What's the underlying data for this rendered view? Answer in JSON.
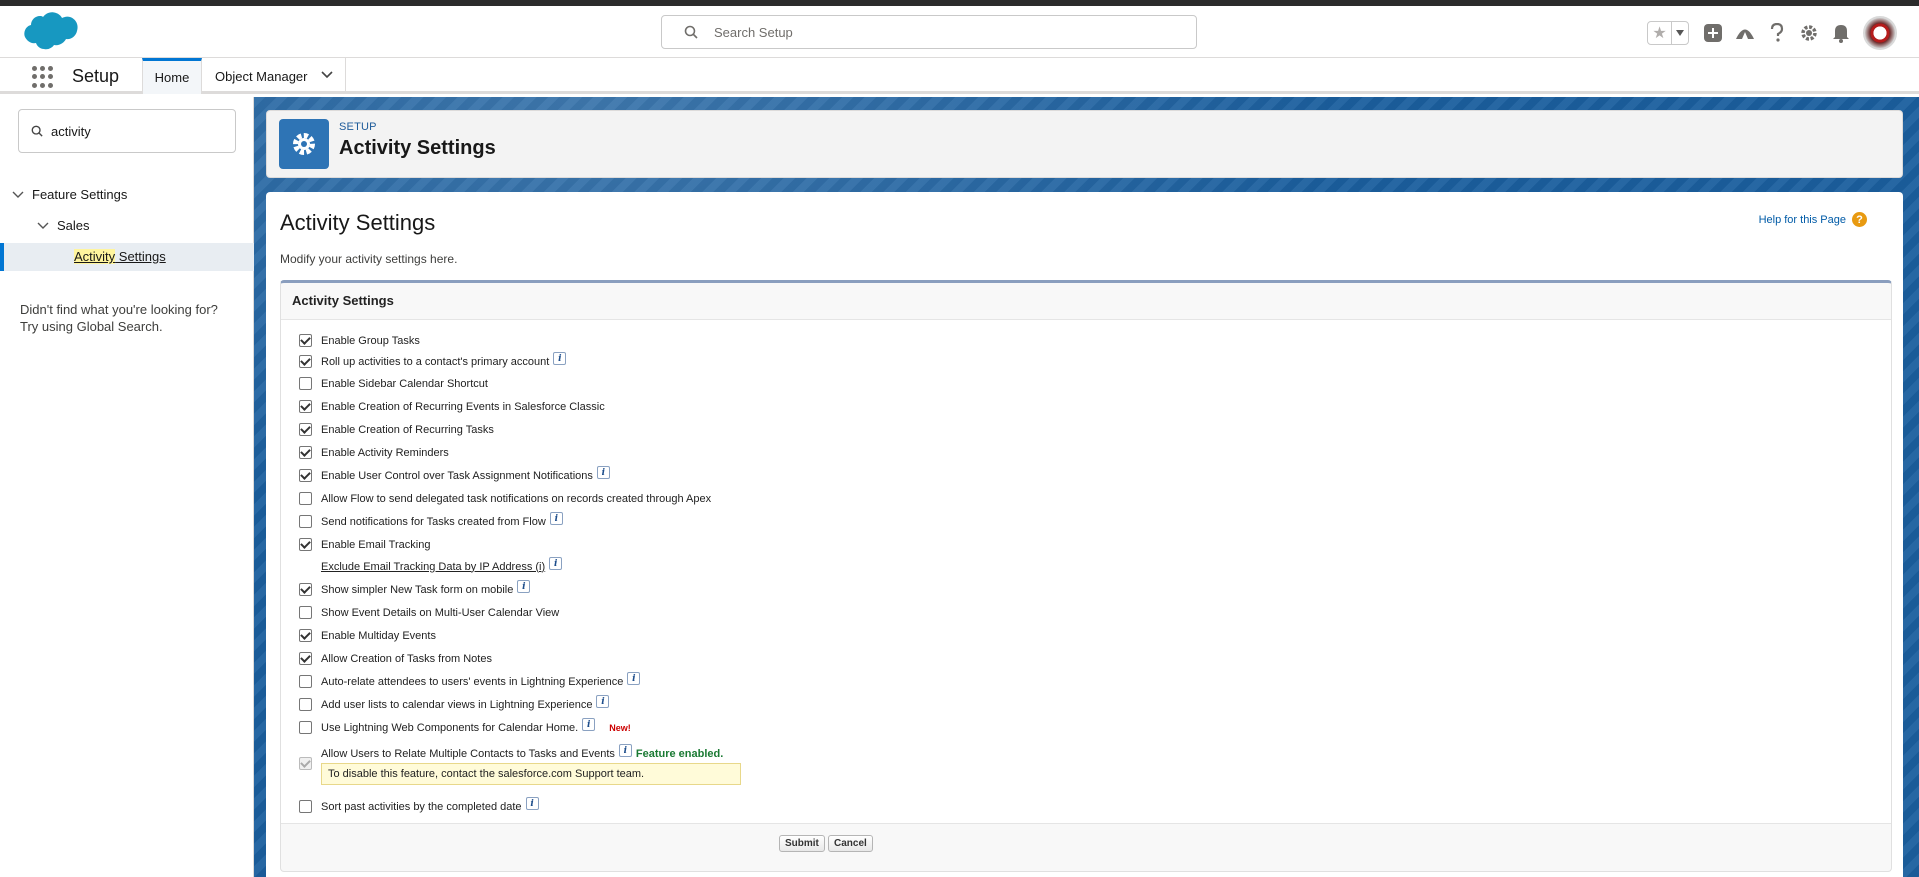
{
  "header": {
    "search_placeholder": "Search Setup"
  },
  "appnav": {
    "app_name": "Setup",
    "tabs": [
      {
        "label": "Home"
      },
      {
        "label": "Object Manager"
      }
    ]
  },
  "sidebar": {
    "quickfind_value": "activity",
    "tree": {
      "level1": "Feature Settings",
      "level2": "Sales",
      "selected_highlight": "Activity",
      "selected_rest": " Settings"
    },
    "notfound_line1": "Didn't find what you're looking for?",
    "notfound_line2": "Try using Global Search."
  },
  "page_header": {
    "eyebrow": "SETUP",
    "title": "Activity Settings"
  },
  "content": {
    "title": "Activity Settings",
    "help_link": "Help for this Page",
    "description": "Modify your activity settings here.",
    "block_title": "Activity Settings",
    "options": [
      {
        "label": "Enable Group Tasks",
        "checked": true
      },
      {
        "label": "Roll up activities to a contact's primary account",
        "checked": true
      },
      {
        "label": "Enable Sidebar Calendar Shortcut",
        "checked": false
      },
      {
        "label": "Enable Creation of Recurring Events in Salesforce Classic",
        "checked": true
      },
      {
        "label": "Enable Creation of Recurring Tasks",
        "checked": true
      },
      {
        "label": "Enable Activity Reminders",
        "checked": true
      },
      {
        "label": "Enable User Control over Task Assignment Notifications",
        "checked": true
      },
      {
        "label": "Allow Flow to send delegated task notifications on records created through Apex",
        "checked": false
      },
      {
        "label": "Send notifications for Tasks created from Flow",
        "checked": false
      },
      {
        "label": "Enable Email Tracking",
        "checked": true
      },
      {
        "label": "Exclude Email Tracking Data by IP Address (i)"
      },
      {
        "label": "Show simpler New Task form on mobile",
        "checked": true
      },
      {
        "label": "Show Event Details on Multi-User Calendar View",
        "checked": false
      },
      {
        "label": "Enable Multiday Events",
        "checked": true
      },
      {
        "label": "Allow Creation of Tasks from Notes",
        "checked": true
      },
      {
        "label": "Auto-relate attendees to users' events in Lightning Experience",
        "checked": false
      },
      {
        "label": "Add user lists to calendar views in Lightning Experience",
        "checked": false
      },
      {
        "label": "Use Lightning Web Components for Calendar Home.",
        "checked": false,
        "tag": "New!"
      },
      {
        "label": "Allow Users to Relate Multiple Contacts to Tasks and Events",
        "checked": true,
        "status": "Feature enabled.",
        "note": "To disable this feature, contact the salesforce.com Support team."
      },
      {
        "label": "Sort past activities by the completed date",
        "checked": false
      }
    ],
    "submit_label": "Submit",
    "cancel_label": "Cancel"
  },
  "colors": {
    "brand_blue": "#0176d3",
    "page_bg": "#1b5f9e",
    "icon_bg": "#2e74b5"
  }
}
